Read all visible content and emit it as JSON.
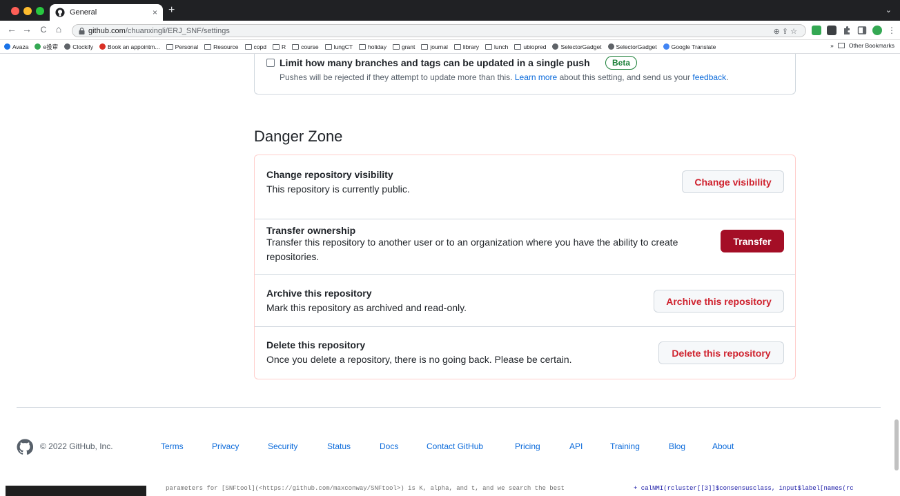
{
  "browser": {
    "tab_title": "General",
    "tab_close": "×",
    "new_tab": "+",
    "tabstrip_menu": "⌄",
    "url_host": "github.com",
    "url_path": "/chuanxingli/ERJ_SNF/settings",
    "omnibox_icons": "⊕  ⇪  ☆",
    "nav": {
      "back": "←",
      "forward": "→",
      "reload": "C",
      "home": "⌂"
    },
    "bookmarks": [
      {
        "label": "Avaza",
        "icon": "avaza-icon",
        "color": "#1a73e8"
      },
      {
        "label": "e投审",
        "icon": "etoushen-icon",
        "color": "#34a853"
      },
      {
        "label": "Clockify",
        "icon": "clockify-icon",
        "color": "#5f6368"
      },
      {
        "label": "Book an appointm...",
        "icon": "booking-icon",
        "color": "#d93025"
      },
      {
        "label": "Personal",
        "icon": "folder-icon"
      },
      {
        "label": "Resource",
        "icon": "folder-icon"
      },
      {
        "label": "copd",
        "icon": "folder-icon"
      },
      {
        "label": "R",
        "icon": "folder-icon"
      },
      {
        "label": "course",
        "icon": "folder-icon"
      },
      {
        "label": "lungCT",
        "icon": "folder-icon"
      },
      {
        "label": "holiday",
        "icon": "folder-icon"
      },
      {
        "label": "grant",
        "icon": "folder-icon"
      },
      {
        "label": "journal",
        "icon": "folder-icon"
      },
      {
        "label": "library",
        "icon": "folder-icon"
      },
      {
        "label": "lunch",
        "icon": "folder-icon"
      },
      {
        "label": "ubiopred",
        "icon": "folder-icon"
      },
      {
        "label": "SelectorGadget",
        "icon": "selectorgadget-icon",
        "color": "#5f6368"
      },
      {
        "label": "SelectorGadget",
        "icon": "selectorgadget-icon",
        "color": "#5f6368"
      },
      {
        "label": "Google Translate",
        "icon": "translate-icon",
        "color": "#4285f4"
      }
    ],
    "bookmarks_overflow": "»",
    "other_bookmarks": "Other Bookmarks"
  },
  "push_limit": {
    "title": "Limit how many branches and tags can be updated in a single push",
    "badge": "Beta",
    "desc_prefix": "Pushes will be rejected if they attempt to update more than this. ",
    "learn_more": "Learn more",
    "desc_middle": " about this setting, and send us your ",
    "feedback": "feedback",
    "desc_suffix": "."
  },
  "danger_zone": {
    "title": "Danger Zone",
    "rows": [
      {
        "title": "Change repository visibility",
        "desc": "This repository is currently public.",
        "button": "Change visibility"
      },
      {
        "title": "Transfer ownership",
        "desc": "Transfer this repository to another user or to an organization where you have the ability to create repositories.",
        "button": "Transfer"
      },
      {
        "title": "Archive this repository",
        "desc": "Mark this repository as archived and read-only.",
        "button": "Archive this repository"
      },
      {
        "title": "Delete this repository",
        "desc": "Once you delete a repository, there is no going back. Please be certain.",
        "button": "Delete this repository"
      }
    ]
  },
  "footer": {
    "copyright": "© 2022 GitHub, Inc.",
    "links": [
      "Terms",
      "Privacy",
      "Security",
      "Status",
      "Docs",
      "Contact GitHub",
      "Pricing",
      "API",
      "Training",
      "Blog",
      "About"
    ]
  },
  "background_window": {
    "left_text": "parameters for [SNFtool](<https://github.com/maxconway/SNFtool>) is K, alpha, and t, and we search the best",
    "right_text": "+    calNMI(rcluster[[3]]$consensusclass, input$label[names(rc"
  },
  "colors": {
    "danger_red": "#cf222e",
    "transfer_bg": "#a40e26",
    "link_blue": "#0969da",
    "beta_green": "#1a7f37"
  }
}
